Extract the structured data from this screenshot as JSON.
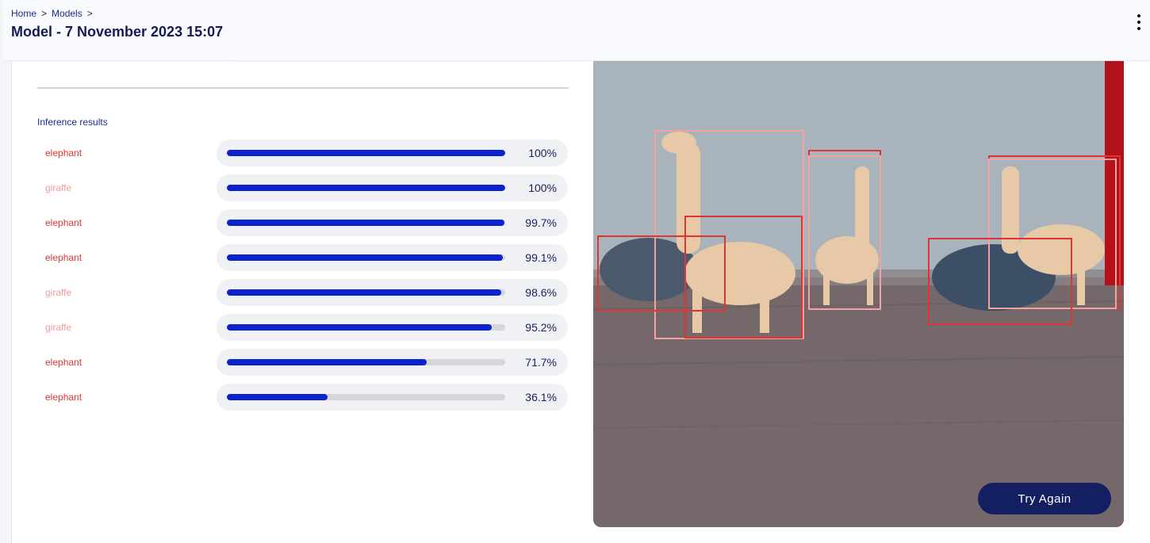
{
  "breadcrumb": {
    "home": "Home",
    "models": "Models",
    "sep": ">"
  },
  "page_title": "Model - 7 November 2023 15:07",
  "inference": {
    "title": "Inference results",
    "results": [
      {
        "label": "elephant",
        "class": "elephant",
        "value": 1.0,
        "pct": "100%"
      },
      {
        "label": "giraffe",
        "class": "giraffe",
        "value": 1.0,
        "pct": "100%"
      },
      {
        "label": "elephant",
        "class": "elephant",
        "value": 0.997,
        "pct": "99.7%"
      },
      {
        "label": "elephant",
        "class": "elephant",
        "value": 0.991,
        "pct": "99.1%"
      },
      {
        "label": "giraffe",
        "class": "giraffe",
        "value": 0.986,
        "pct": "98.6%"
      },
      {
        "label": "giraffe",
        "class": "giraffe",
        "value": 0.952,
        "pct": "95.2%"
      },
      {
        "label": "elephant",
        "class": "elephant",
        "value": 0.717,
        "pct": "71.7%"
      },
      {
        "label": "elephant",
        "class": "elephant",
        "value": 0.361,
        "pct": "36.1%"
      }
    ]
  },
  "colors": {
    "elephant": "#e03434",
    "giraffe": "#f29a9a",
    "bar_fill": "#0a22d0",
    "button": "#141f63"
  },
  "try_again_label": "Try Again"
}
